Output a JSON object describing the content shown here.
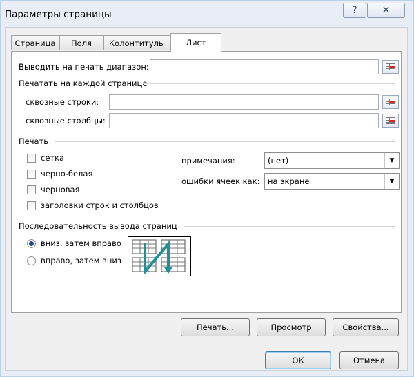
{
  "window": {
    "title": "Параметры страницы",
    "help_glyph": "?",
    "close_glyph": "✕"
  },
  "tabs": [
    {
      "label": "Страница"
    },
    {
      "label": "Поля"
    },
    {
      "label": "Колонтитулы"
    },
    {
      "label": "Лист",
      "active": true
    }
  ],
  "print_area": {
    "label": "Выводить на печать диапазон:",
    "value": ""
  },
  "print_titles": {
    "heading": "Печатать на каждой странице",
    "rows_label": "сквозные строки:",
    "rows_value": "",
    "cols_label": "сквозные столбцы:",
    "cols_value": ""
  },
  "print": {
    "heading": "Печать",
    "checkboxes": [
      {
        "label": "сетка",
        "checked": false
      },
      {
        "label": "черно-белая",
        "checked": false
      },
      {
        "label": "черновая",
        "checked": false
      },
      {
        "label": "заголовки строк и столбцов",
        "checked": false
      }
    ],
    "comments_label": "примечания:",
    "comments_value": "(нет)",
    "errors_label": "ошибки ячеек как:",
    "errors_value": "на экране"
  },
  "page_order": {
    "heading": "Последовательность вывода страниц",
    "options": [
      {
        "label": "вниз, затем вправо",
        "selected": true
      },
      {
        "label": "вправо, затем вниз",
        "selected": false
      }
    ]
  },
  "buttons": {
    "print": "Печать...",
    "preview": "Просмотр",
    "options": "Свойства...",
    "ok": "ОК",
    "cancel": "Отмена"
  },
  "colors": {
    "accent": "#1f8f9a",
    "selected_radio": "#1f4a8a"
  }
}
